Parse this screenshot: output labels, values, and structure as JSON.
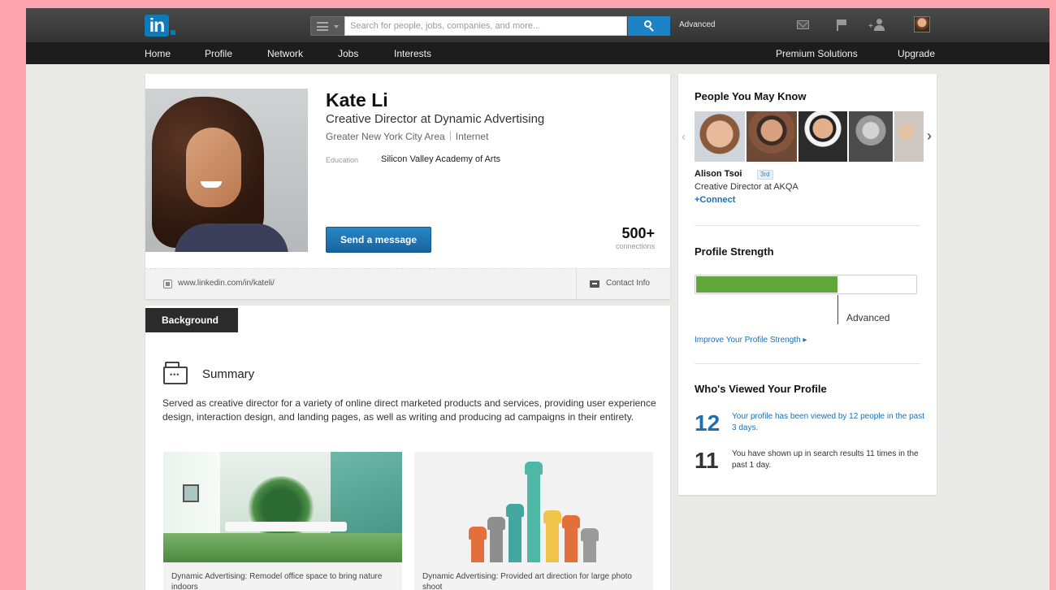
{
  "brand": {
    "logo_text": "in",
    "accent": "#0e7ab8"
  },
  "search": {
    "placeholder": "Search for people, jobs, companies, and more...",
    "advanced_label": "Advanced"
  },
  "top_icons": [
    "mail-icon",
    "flag-icon",
    "add-connection-icon",
    "avatar"
  ],
  "nav": {
    "left": [
      "Home",
      "Profile",
      "Network",
      "Jobs",
      "Interests"
    ],
    "premium": "Premium Solutions",
    "upgrade": "Upgrade"
  },
  "profile": {
    "name": "Kate Li",
    "headline": "Creative Director at Dynamic Advertising",
    "location": "Greater New York City Area",
    "industry": "Internet",
    "education_label": "Education",
    "education_value": "Silicon Valley Academy of Arts",
    "send_message": "Send a message",
    "connections_count": "500+",
    "connections_label": "connections",
    "public_url": "www.linkedin.com/in/kateli/",
    "contact_info": "Contact Info"
  },
  "background": {
    "tab": "Background",
    "summary_title": "Summary",
    "summary_text": "Served as creative director for a variety of online direct marketed products and services, providing user experience design, interaction design, and landing pages, as well as writing and producing ad campaigns in their entirety.",
    "media": [
      {
        "caption": "Dynamic Advertising: Remodel office space to bring nature indoors"
      },
      {
        "caption": "Dynamic Advertising: Provided art direction for large photo shoot"
      }
    ]
  },
  "sidebar": {
    "pymk_title": "People You May Know",
    "suggested": {
      "name": "Alison Tsoi",
      "degree": "3rd",
      "title": "Creative Director at AKQA",
      "connect": "+Connect"
    },
    "strength_title": "Profile Strength",
    "strength_level": "Advanced",
    "strength_fraction": 0.64,
    "improve_link": "Improve Your Profile Strength",
    "viewed_title": "Who's Viewed Your Profile",
    "stats": [
      {
        "number": "12",
        "text": "Your profile has been viewed by 12 people in the past 3 days.",
        "color": "#1c6fb4"
      },
      {
        "number": "11",
        "text": "You have shown up in search results 11 times in the past 1 day.",
        "color": "#333333"
      }
    ]
  },
  "colors": {
    "page_bg": "#fba4ad",
    "link": "#1c6fb4",
    "button": "#1f78b8",
    "strength_fill": "#61a63a"
  }
}
